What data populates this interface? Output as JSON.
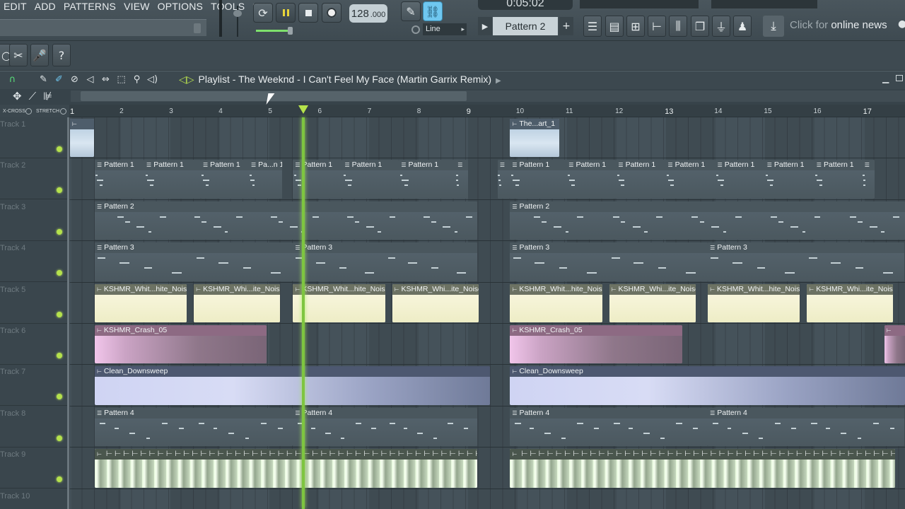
{
  "menu": {
    "items": [
      "EDIT",
      "ADD",
      "PATTERNS",
      "VIEW",
      "OPTIONS",
      "TOOLS",
      "?"
    ]
  },
  "transport": {
    "tempo": "128",
    "tempo_fraction": ".000",
    "song_time": "0:05:02"
  },
  "snap": {
    "label": "Line"
  },
  "pattern_selector": {
    "current": "Pattern 2",
    "add": "+"
  },
  "news": {
    "prefix": "Click for ",
    "text": "online news"
  },
  "playlist": {
    "title": "Playlist - The Weeknd - I Can't Feel My Face (Martin Garrix Remix)",
    "crossfade_label": "X-CROSS",
    "stretch_label": "STRETCH"
  },
  "ruler": {
    "bars": [
      "1",
      "2",
      "3",
      "4",
      "5",
      "6",
      "7",
      "8",
      "9",
      "10",
      "11",
      "12",
      "13",
      "14",
      "15",
      "16",
      "17"
    ]
  },
  "tracks": [
    {
      "label": "Track 1"
    },
    {
      "label": "Track 2"
    },
    {
      "label": "Track 3"
    },
    {
      "label": "Track 4"
    },
    {
      "label": "Track 5"
    },
    {
      "label": "Track 6"
    },
    {
      "label": "Track 7"
    },
    {
      "label": "Track 8"
    },
    {
      "label": "Track 9"
    },
    {
      "label": "Track 10"
    }
  ],
  "clips": {
    "track1": [
      "",
      "The...art_1"
    ],
    "track2": [
      "Pattern 1",
      "Pattern 1",
      "Pattern 1",
      "Pa...n 1",
      "Pattern 1",
      "Pattern 1",
      "Pattern 1",
      "",
      "",
      "Pattern 1",
      "Pattern 1",
      "Pattern 1",
      "Pattern 1",
      "Pattern 1",
      "Pattern 1",
      "Pattern 1",
      ""
    ],
    "track3": [
      "Pattern 2",
      "Pattern 2"
    ],
    "track4": [
      "Pattern 3",
      "Pattern 3",
      "Pattern 3",
      "Pattern 3"
    ],
    "track5": [
      "KSHMR_Whit...hite_Noise",
      "KSHMR_Whi...ite_Noise",
      "KSHMR_Whit...hite_Noise",
      "KSHMR_Whi...ite_Noise",
      "KSHMR_Whit...hite_Noise",
      "KSHMR_Whi...ite_Noise",
      "KSHMR_Whit...hite_Noise",
      "KSHMR_Whi...ite_Noise"
    ],
    "track6": [
      "KSHMR_Crash_05",
      "KSHMR_Crash_05",
      ""
    ],
    "track7": [
      "Clean_Downsweep",
      "Clean_Downsweep"
    ],
    "track8": [
      "Pattern 4",
      "Pattern 4",
      "Pattern 4",
      "Pattern 4"
    ],
    "track9": [
      "",
      ""
    ]
  },
  "colors": {
    "accent_green": "#b5e24c",
    "snap_blue": "#6fc7f0",
    "noise_clip": "#f4f3d5",
    "crash_clip": "#f1c5ea",
    "sweep_clip": "#cfd4f3"
  }
}
